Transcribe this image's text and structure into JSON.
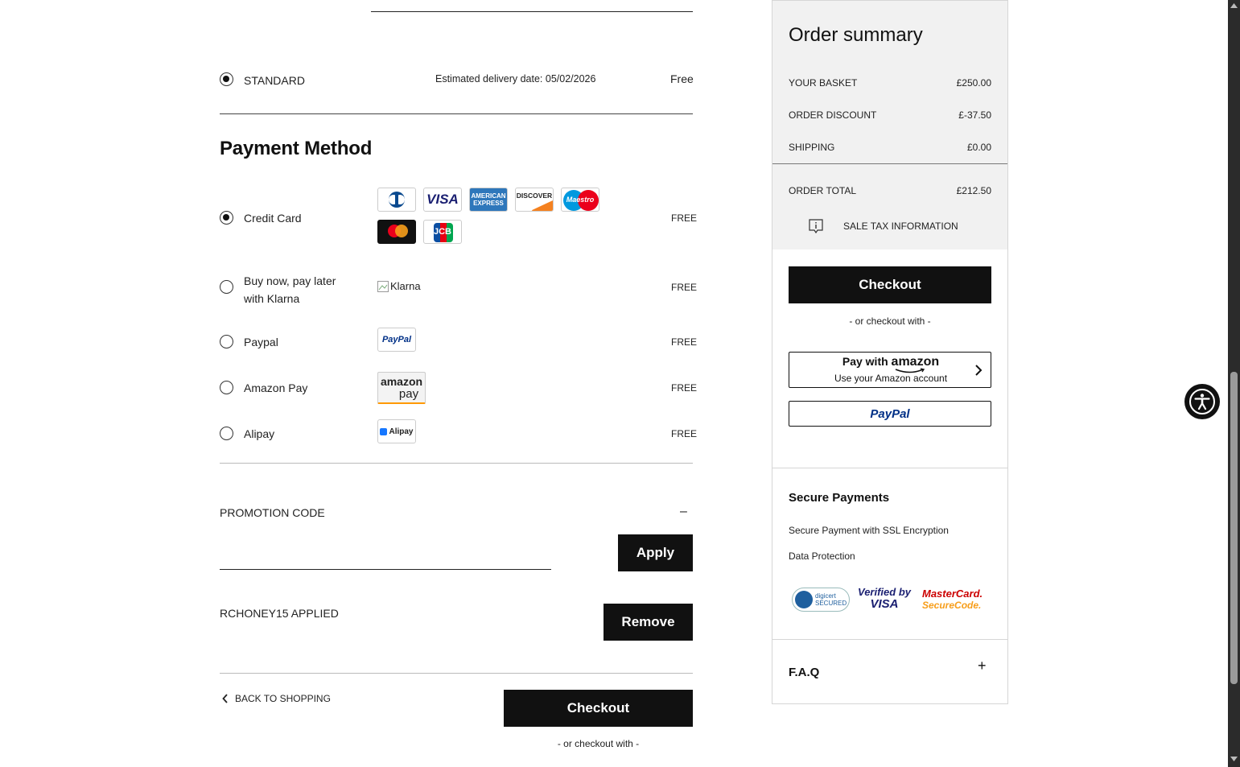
{
  "shipping": {
    "option_label": "STANDARD",
    "estimated_delivery": "Estimated delivery date: 05/02/2026",
    "price": "Free"
  },
  "payment": {
    "heading": "Payment Method",
    "methods": [
      {
        "label": "Credit Card",
        "fee": "FREE",
        "selected": true
      },
      {
        "label_line1": "Buy now, pay later",
        "label_line2": "with Klarna",
        "logo_alt": "Klarna",
        "fee": "FREE",
        "selected": false
      },
      {
        "label": "Paypal",
        "fee": "FREE",
        "selected": false
      },
      {
        "label": "Amazon Pay",
        "fee": "FREE",
        "selected": false
      },
      {
        "label": "Alipay",
        "fee": "FREE",
        "selected": false
      }
    ],
    "card_logos": {
      "visa": "VISA",
      "amex_line1": "AMERICAN",
      "amex_line2": "EXPRESS",
      "discover": "DISCOVER",
      "maestro": "Maestro",
      "jcb": "JCB",
      "paypal_badge": "PayPal",
      "amazon_line1": "amazon",
      "amazon_line2": "pay",
      "alipay_badge": "Alipay"
    }
  },
  "promotion": {
    "label": "PROMOTION CODE",
    "toggle": "–",
    "input_value": "",
    "apply_label": "Apply",
    "applied_text": "RCHONEY15 APPLIED",
    "remove_label": "Remove"
  },
  "footer_actions": {
    "back_label": "BACK TO SHOPPING",
    "checkout_label": "Checkout",
    "or_checkout_with": "- or checkout with -"
  },
  "summary": {
    "title": "Order summary",
    "rows": [
      {
        "label": "YOUR BASKET",
        "value": "£250.00"
      },
      {
        "label": "ORDER DISCOUNT",
        "value": "£-37.50"
      },
      {
        "label": "SHIPPING",
        "value": "£0.00"
      }
    ],
    "total_label": "ORDER TOTAL",
    "total_value": "£212.50",
    "tax_info": "SALE TAX INFORMATION",
    "checkout_label": "Checkout",
    "or_checkout_with": "- or checkout with -",
    "amazon_button_line1_prefix": "Pay with",
    "amazon_button_line1_brand": "amazon",
    "amazon_button_line2": "Use your Amazon account",
    "paypal_button": "PayPal"
  },
  "secure": {
    "title": "Secure Payments",
    "items": [
      "Secure Payment with SSL Encryption",
      "Data Protection"
    ],
    "digicert_line1": "digicert",
    "digicert_line2": "SECURED",
    "verified_line1": "Verified by",
    "verified_line2": "VISA",
    "mc_line1": "MasterCard.",
    "mc_line2": "SecureCode."
  },
  "faq": {
    "title": "F.A.Q",
    "toggle": "+"
  },
  "colors": {
    "primary_button": "#111111",
    "panel_background": "#f1f1f1",
    "paypal_dark": "#003087",
    "paypal_light": "#009cde",
    "maestro_blue": "#0099df",
    "maestro_red": "#eb001b",
    "mastercard_orange": "#f79e1b"
  }
}
